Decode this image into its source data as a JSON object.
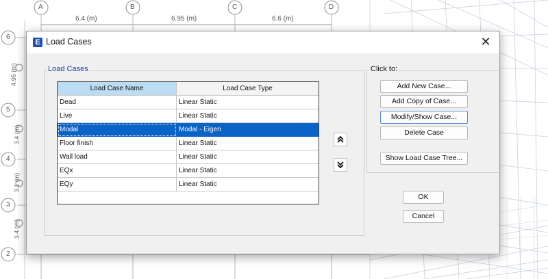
{
  "background": {
    "grid_columns": [
      "A",
      "B",
      "C",
      "D"
    ],
    "grid_rows": [
      "6",
      "5",
      "4",
      "3",
      "2"
    ],
    "spans": [
      "6.4 (m)",
      "6.95 (m)",
      "6.6 (m)"
    ],
    "row_spans": [
      "4.95 (m)",
      "3.4 (m)",
      "3.1 (m)",
      "3.4 (m)"
    ]
  },
  "dialog": {
    "title": "Load Cases",
    "icon_letter": "E",
    "close_glyph": "✕"
  },
  "load_cases": {
    "group_label": "Load Cases",
    "columns": [
      "Load Case Name",
      "Load Case Type"
    ],
    "rows": [
      {
        "name": "Dead",
        "type": "Linear Static"
      },
      {
        "name": "Live",
        "type": "Linear Static"
      },
      {
        "name": "Modal",
        "type": "Modal - Eigen"
      },
      {
        "name": "Floor finish",
        "type": "Linear Static"
      },
      {
        "name": "Wall load",
        "type": "Linear Static"
      },
      {
        "name": "EQx",
        "type": "Linear Static"
      },
      {
        "name": "EQy",
        "type": "Linear Static"
      }
    ],
    "selected": "Modal",
    "move_up_glyph": "⯅⯅",
    "move_down_glyph": "⯆⯆"
  },
  "click_to": {
    "group_label": "Click to:",
    "add_new": "Add New Case...",
    "add_copy": "Add Copy of Case...",
    "modify_show": "Modify/Show Case...",
    "delete": "Delete Case",
    "show_tree": "Show Load Case Tree..."
  },
  "footer": {
    "ok": "OK",
    "cancel": "Cancel"
  }
}
